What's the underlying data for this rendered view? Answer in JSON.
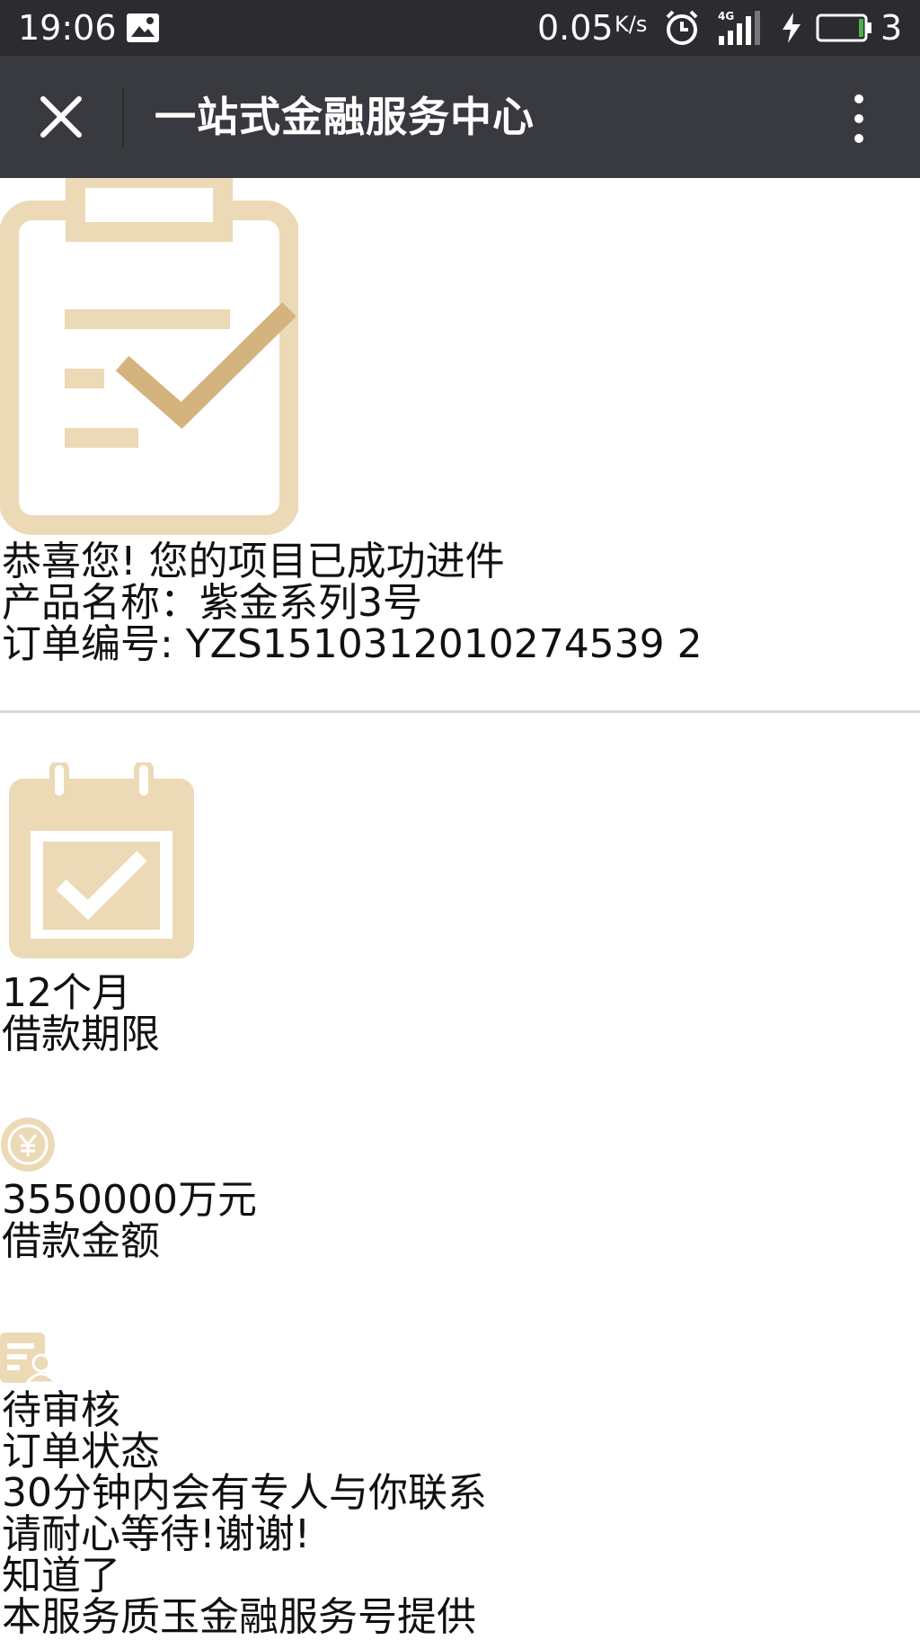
{
  "status_bar": {
    "time": "19:06",
    "network_speed": "0.05",
    "network_speed_unit": "K/s",
    "network_type": "4G",
    "battery_level": "3",
    "icons": [
      "image-notification-icon",
      "alarm-icon",
      "signal-icon",
      "charging-icon",
      "battery-icon"
    ]
  },
  "title_bar": {
    "title": "一站式金融服务中心",
    "close_icon": "close-icon",
    "more_icon": "more-vertical-icon"
  },
  "success": {
    "icon": "clipboard-check-icon",
    "message": "恭喜您! 您的项目已成功进件",
    "product_line": "产品名称：紫金系列3号",
    "order_line": "订单编号: YZS1510312010274539 2"
  },
  "loan_term": {
    "icon": "calendar-check-icon",
    "value": "12个月",
    "label": "借款期限"
  },
  "loan_amount": {
    "icon": "yuan-coin-icon",
    "value": "3550000万元",
    "label": "借款金额"
  },
  "order_status": {
    "icon": "document-user-icon",
    "value": "待审核",
    "label": "订单状态",
    "contact_note": "30分钟内会有专人与你联系",
    "wait_note": "请耐心等待!谢谢!",
    "ok_link": "知道了",
    "provider_note": "本服务质玉金融服务号提供"
  },
  "colors": {
    "status_bar_bg": "#2b2b30",
    "title_bar_bg": "#393a3f",
    "icon_gold_light": "#ecd9b6",
    "icon_gold_dark": "#d4b37e"
  }
}
